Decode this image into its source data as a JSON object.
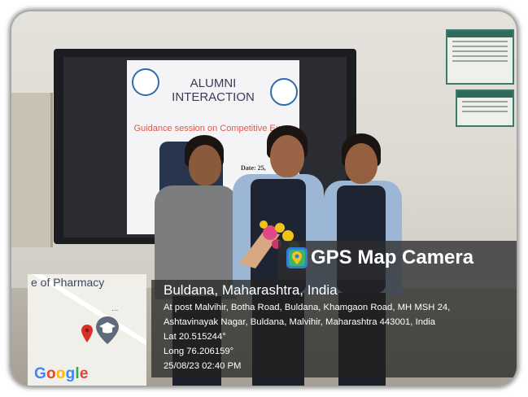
{
  "slide": {
    "title_line1": "ALUMNI",
    "title_line2": "INTERACTION",
    "subtitle": "Guidance session on Competitive Exam",
    "date_text": "Date: 25,"
  },
  "map": {
    "place_label": "e of Pharmacy",
    "more_glyph": "...",
    "logo_letters": [
      "G",
      "o",
      "o",
      "g",
      "l",
      "e"
    ]
  },
  "gps": {
    "brand": "GPS Map Camera",
    "location": "Buldana, Maharashtra, India",
    "address_line1": "At post Malvihir, Botha Road, Buldana, Khamgaon Road, MH MSH 24,",
    "address_line2": "Ashtavinayak Nagar, Buldana, Malvihir, Maharashtra 443001, India",
    "lat": "Lat 20.515244°",
    "long": "Long 76.206159°",
    "datetime": "25/08/23 02:40 PM"
  },
  "colors": {
    "google": [
      "#4285F4",
      "#EA4335",
      "#FBBC05",
      "#4285F4",
      "#34A853",
      "#EA4335"
    ],
    "pin": "#d93025",
    "overlay": "#2d2d2d"
  }
}
